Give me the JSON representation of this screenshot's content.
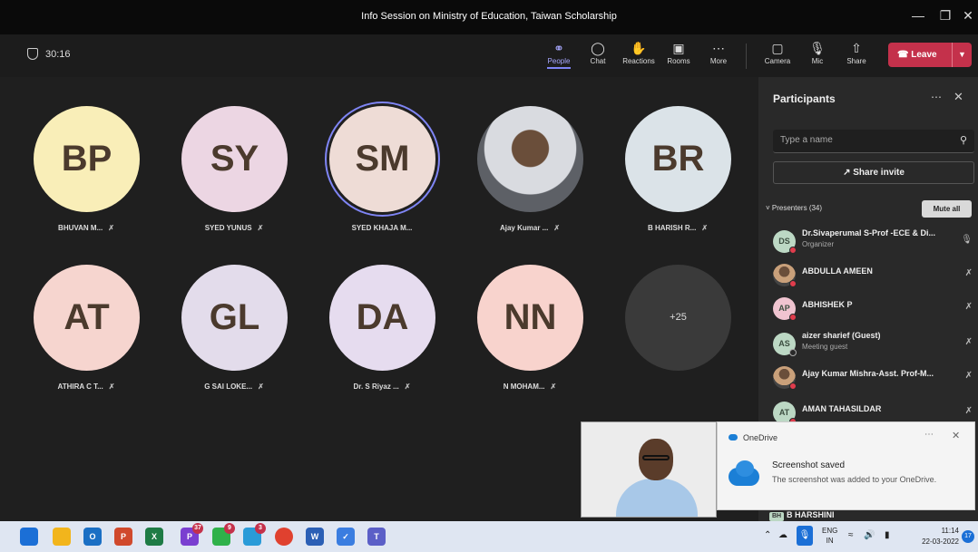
{
  "window": {
    "title": "Info Session on Ministry of Education, Taiwan Scholarship"
  },
  "toolbar": {
    "timer": "30:16",
    "buttons": [
      {
        "label": "People",
        "icon": "people-icon"
      },
      {
        "label": "Chat",
        "icon": "chat-icon"
      },
      {
        "label": "Reactions",
        "icon": "reactions-icon"
      },
      {
        "label": "Rooms",
        "icon": "rooms-icon"
      },
      {
        "label": "More",
        "icon": "more-icon"
      },
      {
        "label": "Camera",
        "icon": "camera-icon"
      },
      {
        "label": "Mic",
        "icon": "mic-icon"
      },
      {
        "label": "Share",
        "icon": "share-icon"
      }
    ],
    "leave_label": "Leave"
  },
  "stage": {
    "tiles": [
      {
        "initials": "BP",
        "name": "BHUVAN M...",
        "color": "#f9eeb8"
      },
      {
        "initials": "SY",
        "name": "SYED YUNUS",
        "color": "#ecd6e3"
      },
      {
        "initials": "SM",
        "name": "SYED KHAJA M...",
        "color": "#eedcd6"
      },
      {
        "initials": "",
        "name": "Ajay Kumar ...",
        "color": "photo"
      },
      {
        "initials": "BR",
        "name": "B HARISH R...",
        "color": "#dbe3e8"
      },
      {
        "initials": "AT",
        "name": "ATHIRA C T...",
        "color": "#f6d5cf"
      },
      {
        "initials": "GL",
        "name": "G SAI LOKE...",
        "color": "#e3dceb"
      },
      {
        "initials": "DA",
        "name": "Dr. S Riyaz ...",
        "color": "#e6dcef"
      },
      {
        "initials": "NN",
        "name": "N MOHAM...",
        "color": "#f8d3cd"
      },
      {
        "initials": "+25",
        "name": "",
        "color": "#3a3a3a"
      }
    ]
  },
  "panel": {
    "title": "Participants",
    "search_placeholder": "Type a name",
    "share_invite": "Share invite",
    "presenters_label": "Presenters (34)",
    "mute_all": "Mute all",
    "participants": [
      {
        "initials": "DS",
        "name": "Dr.Sivaperumal S-Prof -ECE & Di...",
        "sub": "Organizer",
        "photo": false
      },
      {
        "initials": "",
        "name": "ABDULLA AMEEN",
        "sub": "",
        "photo": true
      },
      {
        "initials": "AP",
        "name": "ABHISHEK P",
        "sub": "",
        "photo": false
      },
      {
        "initials": "AS",
        "name": "aizer sharief (Guest)",
        "sub": "Meeting guest",
        "photo": false
      },
      {
        "initials": "",
        "name": "Ajay Kumar Mishra-Asst. Prof-M...",
        "sub": "",
        "photo": true
      },
      {
        "initials": "AT",
        "name": "AMAN TAHASILDAR",
        "sub": "",
        "photo": false
      }
    ],
    "peek": {
      "initials": "BH",
      "name": "B HARSHINI"
    }
  },
  "toast": {
    "app": "OneDrive",
    "heading": "Screenshot saved",
    "body": "The screenshot was added to your OneDrive."
  },
  "taskbar": {
    "apps": [
      {
        "icon": "windows-start-icon",
        "color": "#1b6fd6",
        "text": "",
        "badge": ""
      },
      {
        "icon": "file-explorer-icon",
        "color": "#f2b51c",
        "text": "",
        "badge": ""
      },
      {
        "icon": "outlook-icon",
        "color": "#1a6fc4",
        "text": "O",
        "badge": ""
      },
      {
        "icon": "powerpoint-icon",
        "color": "#d0492c",
        "text": "P",
        "badge": ""
      },
      {
        "icon": "excel-icon",
        "color": "#1e7b45",
        "text": "X",
        "badge": ""
      },
      {
        "icon": "powerpoint-icon-2",
        "color": "#7a3fd0",
        "text": "P",
        "badge": "37"
      },
      {
        "icon": "whatsapp-icon",
        "color": "#2fb14a",
        "text": "",
        "badge": "9"
      },
      {
        "icon": "telegram-icon",
        "color": "#2a9bd8",
        "text": "",
        "badge": "3"
      },
      {
        "icon": "chrome-icon",
        "color": "#e0412f",
        "text": "",
        "badge": ""
      },
      {
        "icon": "word-icon",
        "color": "#2b5fb5",
        "text": "W",
        "badge": ""
      },
      {
        "icon": "todo-icon",
        "color": "#3a7de0",
        "text": "",
        "badge": ""
      },
      {
        "icon": "teams-icon",
        "color": "#5b5fc7",
        "text": "T",
        "badge": ""
      }
    ],
    "lang_line1": "ENG",
    "lang_line2": "IN",
    "time": "11:14",
    "date": "22-03-2022",
    "notifications": "17"
  }
}
